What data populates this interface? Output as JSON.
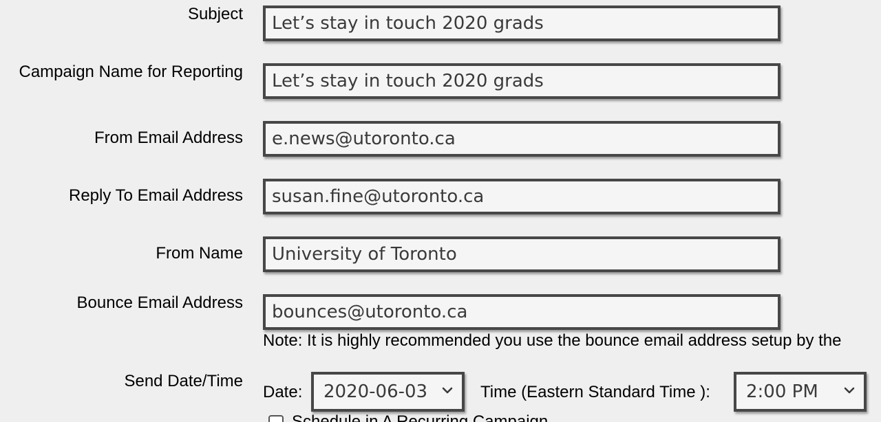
{
  "fields": [
    {
      "label": "Subject",
      "value": "Let’s stay in touch 2020 grads"
    },
    {
      "label": "Campaign Name for Reporting",
      "value": "Let’s stay in touch 2020 grads"
    },
    {
      "label": "From Email Address",
      "value": "e.news@utoronto.ca"
    },
    {
      "label": "Reply To Email Address",
      "value": "susan.fine@utoronto.ca"
    },
    {
      "label": "From Name",
      "value": "University of Toronto"
    },
    {
      "label": "Bounce Email Address",
      "value": "bounces@utoronto.ca"
    }
  ],
  "note": "Note: It is highly recommended you use the bounce email address setup by the",
  "send": {
    "label": "Send Date/Time",
    "date_label": "Date:",
    "date_value": "2020-06-03",
    "time_label": "Time (Eastern Standard Time ):",
    "time_value": "2:00 PM"
  },
  "checkbox_label": "Schedule in A Recurring Campaign"
}
